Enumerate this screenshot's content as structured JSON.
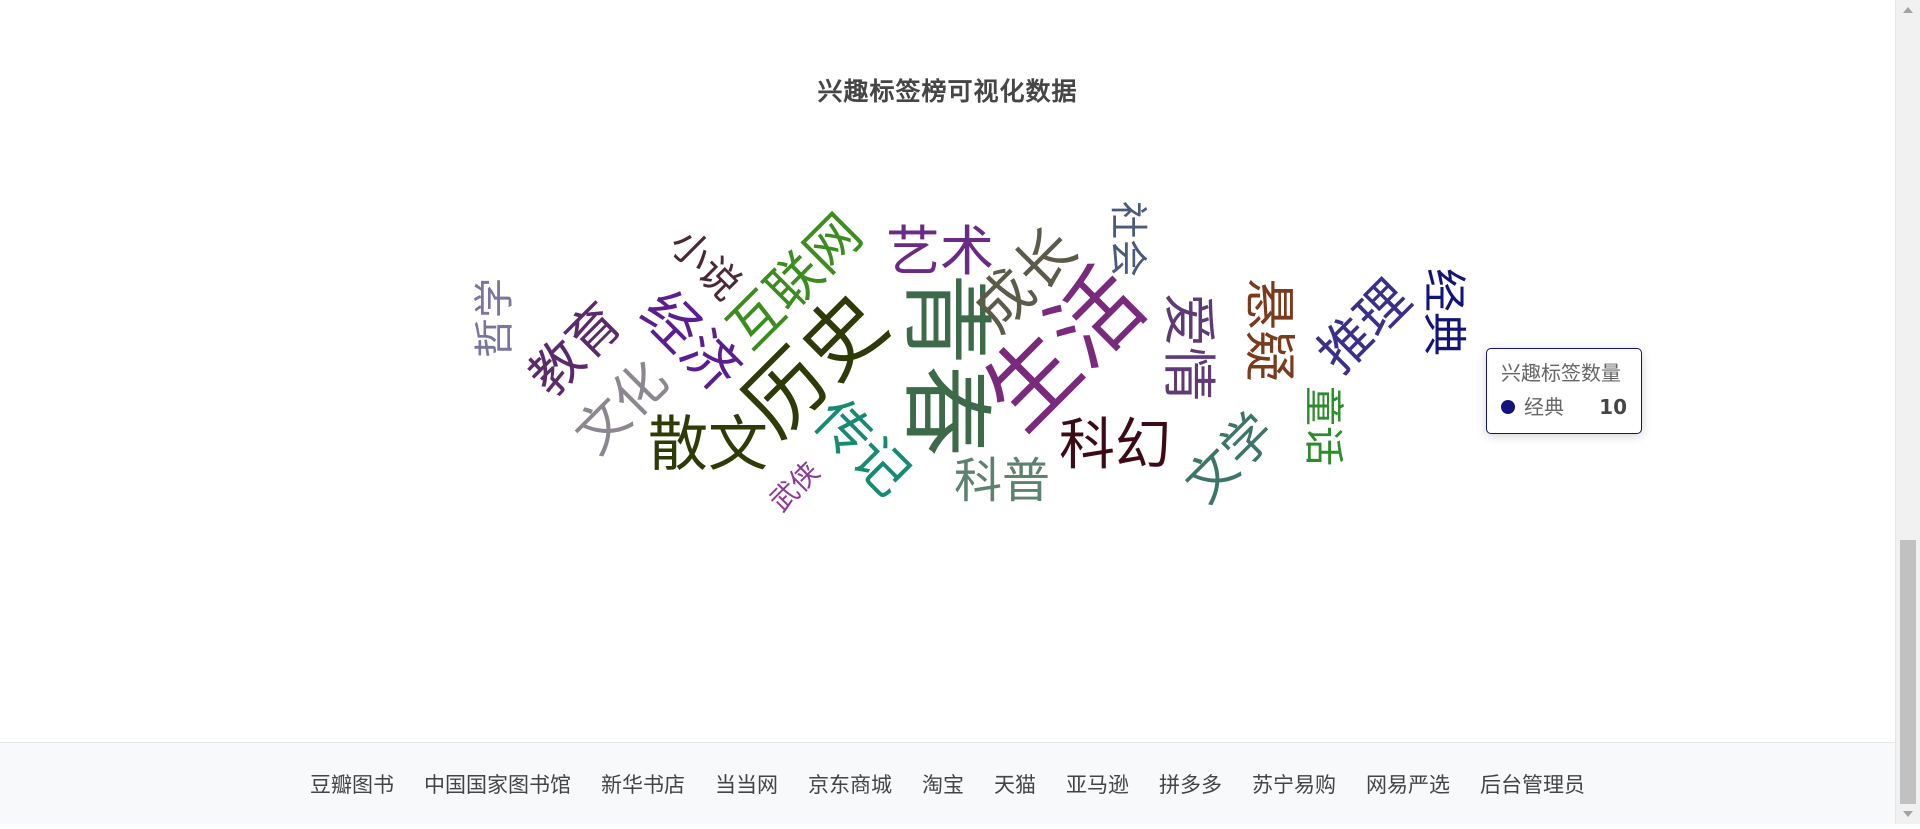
{
  "page": {
    "footer_links": [
      "豆瓣图书",
      "中国国家图书馆",
      "新华书店",
      "当当网",
      "京东商城",
      "淘宝",
      "天猫",
      "亚马逊",
      "拼多多",
      "苏宁易购",
      "网易严选",
      "后台管理员"
    ]
  },
  "chart_data": {
    "type": "wordcloud",
    "title": "兴趣标签榜可视化数据",
    "series_name": "兴趣标签数量",
    "words": [
      {
        "name": "青春",
        "color": "#3d6b4a"
      },
      {
        "name": "生活",
        "color": "#7a2a7d"
      },
      {
        "name": "历史",
        "color": "#2e3a08"
      },
      {
        "name": "散文",
        "color": "#2f3b06"
      },
      {
        "name": "科幻",
        "color": "#3b0b18"
      },
      {
        "name": "成长",
        "color": "#5c5a48"
      },
      {
        "name": "艺术",
        "color": "#6b2a85"
      },
      {
        "name": "互联网",
        "color": "#3d8c20"
      },
      {
        "name": "经济",
        "color": "#5a1e91"
      },
      {
        "name": "教育",
        "color": "#5a2a6b"
      },
      {
        "name": "文化",
        "color": "#8c8690"
      },
      {
        "name": "传记",
        "color": "#178a72"
      },
      {
        "name": "爱情",
        "color": "#5e3a78"
      },
      {
        "name": "悬疑",
        "color": "#7a3a1c"
      },
      {
        "name": "推理",
        "color": "#3a2f8a"
      },
      {
        "name": "文学",
        "color": "#3f7468"
      },
      {
        "name": "科普",
        "color": "#5e8270"
      },
      {
        "name": "经典",
        "color": "#14137a",
        "value": 10
      },
      {
        "name": "童话",
        "color": "#2c8c2c"
      },
      {
        "name": "小说",
        "color": "#4a2838"
      },
      {
        "name": "哲学",
        "color": "#7a74a0"
      },
      {
        "name": "社会",
        "color": "#4a5a7a"
      },
      {
        "name": "武侠",
        "color": "#8c3a96"
      }
    ],
    "tooltip": {
      "title": "兴趣标签数量",
      "name": "经典",
      "value": 10,
      "color": "#14137a"
    }
  }
}
